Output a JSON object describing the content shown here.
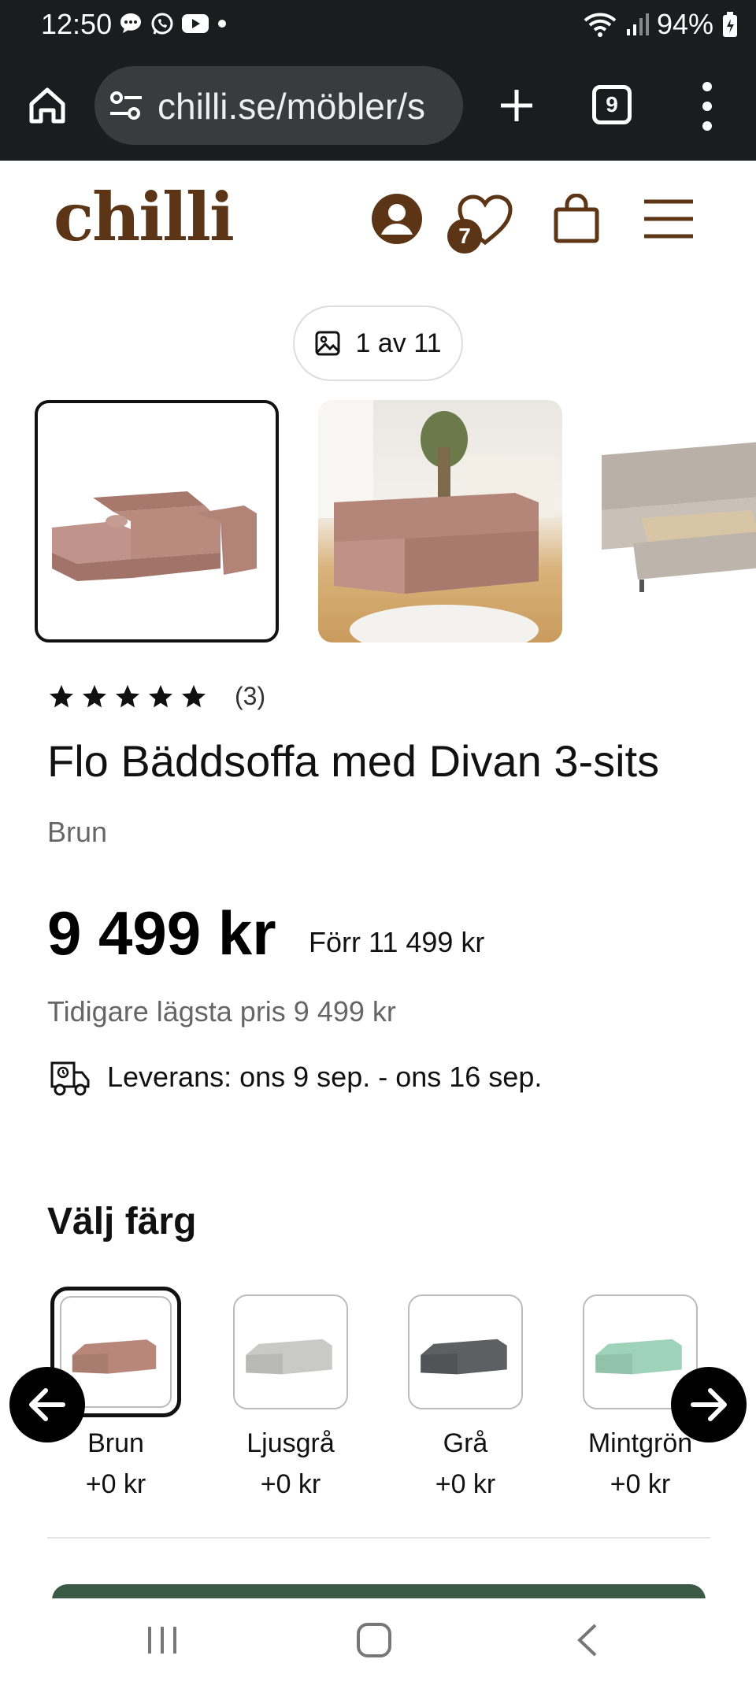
{
  "status_bar": {
    "time": "12:50",
    "battery": "94%"
  },
  "browser": {
    "url": "chilli.se/möbler/s",
    "tab_count": "9"
  },
  "header": {
    "logo": "chilli",
    "wishlist_count": "7",
    "brand_color": "#5c3516"
  },
  "gallery": {
    "counter": "1 av 11"
  },
  "product": {
    "rating_stars": 5,
    "rating_count": "(3)",
    "title": "Flo Bäddsoffa med Divan 3-sits",
    "color": "Brun",
    "price": "9 499 kr",
    "price_before": "Förr 11 499 kr",
    "lowest_price": "Tidigare lägsta pris 9 499 kr",
    "delivery": "Leverans: ons 9 sep. - ons 16 sep."
  },
  "color_selector": {
    "heading": "Välj färg",
    "options": [
      {
        "name": "Brun",
        "price": "+0 kr",
        "swatch": "#b8877a",
        "selected": true
      },
      {
        "name": "Ljusgrå",
        "price": "+0 kr",
        "swatch": "#c9c9c7",
        "selected": false
      },
      {
        "name": "Grå",
        "price": "+0 kr",
        "swatch": "#5d5f63",
        "selected": false
      },
      {
        "name": "Mintgrön",
        "price": "+0 kr",
        "swatch": "#9fd3b9",
        "selected": false
      }
    ]
  },
  "icons": {
    "home": "home-icon",
    "site_info": "site-info-icon",
    "new_tab": "plus-icon",
    "tabs": "tabs-icon",
    "more": "more-vertical-icon",
    "account": "account-icon",
    "wishlist": "heart-icon",
    "cart": "shopping-bag-icon",
    "menu": "hamburger-menu-icon",
    "gallery": "image-icon",
    "delivery": "delivery-truck-icon",
    "prev": "arrow-left-icon",
    "next": "arrow-right-icon"
  }
}
